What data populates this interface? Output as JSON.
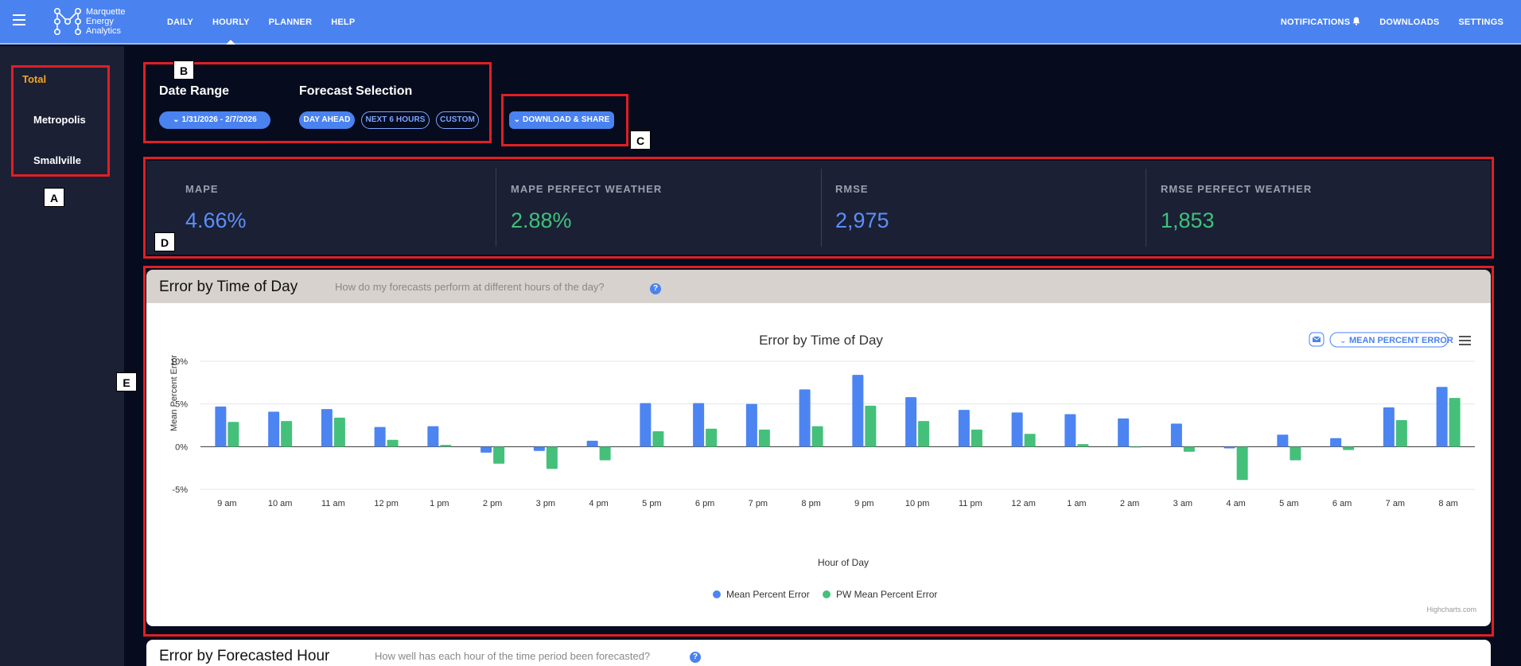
{
  "brand": {
    "line1": "Marquette",
    "line2": "Energy",
    "line3": "Analytics"
  },
  "nav": {
    "left": [
      {
        "label": "DAILY",
        "active": false
      },
      {
        "label": "HOURLY",
        "active": true
      },
      {
        "label": "PLANNER",
        "active": false
      },
      {
        "label": "HELP",
        "active": false
      }
    ],
    "notifications": "NOTIFICATIONS",
    "downloads": "DOWNLOADS",
    "settings": "SETTINGS"
  },
  "sidebar": {
    "total": "Total",
    "items": [
      "Metropolis",
      "Smallville"
    ]
  },
  "filters": {
    "date_range_title": "Date Range",
    "date_range_value": "1/31/2026 - 2/7/2026",
    "forecast_title": "Forecast Selection",
    "forecast_options": [
      "DAY AHEAD",
      "NEXT 6 HOURS",
      "CUSTOM"
    ],
    "download_share": "DOWNLOAD & SHARE"
  },
  "kpis": [
    {
      "label": "MAPE",
      "value": "4.66%",
      "color": "#5b8ff9"
    },
    {
      "label": "MAPE PERFECT WEATHER",
      "value": "2.88%",
      "color": "#3ec27a"
    },
    {
      "label": "RMSE",
      "value": "2,975",
      "color": "#5b8ff9"
    },
    {
      "label": "RMSE PERFECT WEATHER",
      "value": "1,853",
      "color": "#3ec27a"
    }
  ],
  "annotations": {
    "a": "A",
    "b": "B",
    "c": "C",
    "d": "D",
    "e": "E"
  },
  "card1": {
    "title": "Error by Time of Day",
    "subtitle": "How do my forecasts perform at different hours of the day?",
    "help": "?",
    "metric_dropdown": "MEAN PERCENT ERROR",
    "credit": "Highcharts.com"
  },
  "card2": {
    "title": "Error by Forecasted Hour",
    "subtitle": "How well has each hour of the time period been forecasted?",
    "help": "?"
  },
  "colors": {
    "accent": "#4a82f0",
    "series1": "#4c84f2",
    "series2": "#44c07a",
    "highlight": "#f5a623"
  },
  "chart_data": {
    "type": "bar",
    "title": "Error by Time of Day",
    "xlabel": "Hour of Day",
    "ylabel": "Mean Percent Error",
    "ylim": [
      -5,
      10
    ],
    "yticks": [
      -5,
      0,
      5,
      10
    ],
    "ytick_labels": [
      "-5%",
      "0%",
      "5%",
      "10%"
    ],
    "grid": true,
    "legend": "bottom-center",
    "categories": [
      "9 am",
      "10 am",
      "11 am",
      "12 pm",
      "1 pm",
      "2 pm",
      "3 pm",
      "4 pm",
      "5 pm",
      "6 pm",
      "7 pm",
      "8 pm",
      "9 pm",
      "10 pm",
      "11 pm",
      "12 am",
      "1 am",
      "2 am",
      "3 am",
      "4 am",
      "5 am",
      "6 am",
      "7 am",
      "8 am"
    ],
    "series": [
      {
        "name": "Mean Percent Error",
        "color": "#4c84f2",
        "values": [
          4.7,
          4.1,
          4.4,
          2.3,
          2.4,
          -0.7,
          -0.5,
          0.7,
          5.1,
          5.1,
          5.0,
          6.7,
          8.4,
          5.8,
          4.3,
          4.0,
          3.8,
          3.3,
          2.7,
          -0.2,
          1.4,
          1.0,
          4.6,
          7.0
        ]
      },
      {
        "name": "PW Mean Percent Error",
        "color": "#44c07a",
        "values": [
          2.9,
          3.0,
          3.4,
          0.8,
          0.2,
          -2.0,
          -2.6,
          -1.6,
          1.8,
          2.1,
          2.0,
          2.4,
          4.8,
          3.0,
          2.0,
          1.5,
          0.3,
          -0.1,
          -0.6,
          -3.9,
          -1.6,
          -0.4,
          3.1,
          5.7
        ]
      }
    ]
  }
}
